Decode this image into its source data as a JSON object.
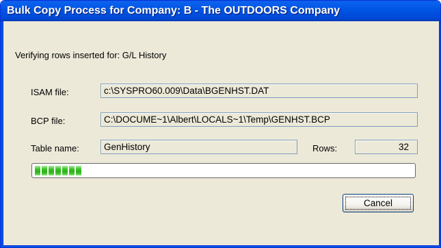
{
  "window": {
    "title": "Bulk Copy Process for Company: B - The OUTDOORS Company"
  },
  "status": {
    "message": "Verifying rows inserted for: G/L History"
  },
  "fields": {
    "isam_label": "ISAM file:",
    "isam_value": "c:\\SYSPRO60.009\\Data\\BGENHST.DAT",
    "bcp_label": "BCP file:",
    "bcp_value": "C:\\DOCUME~1\\Albert\\LOCALS~1\\Temp\\GENHST.BCP",
    "table_label": "Table name:",
    "table_value": "GenHistory",
    "rows_label": "Rows:",
    "rows_value": "32"
  },
  "progress": {
    "fraction": 0.13,
    "color": "#2bb01a"
  },
  "buttons": {
    "cancel_label": "Cancel"
  },
  "colors": {
    "titlebar": "#0054e3",
    "dialog_background": "#ece9d8"
  }
}
